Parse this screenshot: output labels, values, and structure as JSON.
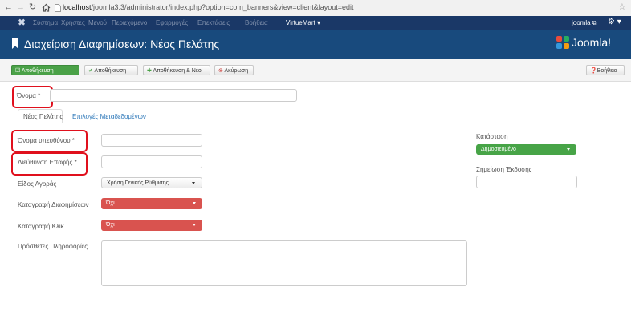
{
  "browser": {
    "back_icon": "back-arrow-icon",
    "forward_icon": "forward-arrow-icon",
    "reload_icon": "reload-icon",
    "home_icon": "home-icon",
    "page_icon": "page-icon",
    "url_host": "localhost",
    "url_path": "/joomla3.3/administrator/index.php?option=com_banners&view=client&layout=edit",
    "star_icon": "star-icon"
  },
  "topbar": {
    "logo_icon": "joomla-x-icon",
    "menu": [
      "Σύστημα",
      "Χρήστες",
      "Μενού",
      "Περιεχόμενο",
      "Εφαρμογές",
      "Επεκτάσεις",
      "Βοήθεια",
      "VirtueMart"
    ],
    "user_label": "joomla",
    "gear_icon": "gear-icon"
  },
  "header": {
    "title": "Διαχείριση Διαφημίσεων: Νέος Πελάτης",
    "brand": "Joomla!"
  },
  "toolbar": {
    "save": "Αποθήκευση",
    "save_close": "Αποθήκευση",
    "save_new": "Αποθήκευση & Νέο",
    "cancel": "Ακύρωση",
    "help": "Βοήθεια"
  },
  "form": {
    "name_label": "Όνομα *",
    "name_value": "",
    "tabs": [
      "Νέος Πελάτης",
      "Επιλογές Μεταδεδομένων"
    ],
    "contact_label": "Όνομα υπευθύνου *",
    "contact_value": "",
    "email_label": "Διεύθυνση Επαφής *",
    "email_value": "",
    "purchase_label": "Είδος Αγοράς",
    "purchase_value": "Χρήση Γενικής Ρύθμισης",
    "track_impressions_label": "Καταγραφή Διαφημίσεων",
    "track_impressions_value": "Όχι",
    "track_clicks_label": "Καταγραφή Κλικ",
    "track_clicks_value": "Όχι",
    "extra_label": "Πρόσθετες Πληροφορίες",
    "extra_value": "",
    "status_label": "Κατάσταση",
    "status_value": "Δημοσιευμένο",
    "version_note_label": "Σημείωση Έκδοσης",
    "version_note_value": ""
  },
  "colors": {
    "topbar": "#1a3867",
    "titlebar": "#184a7d",
    "save_green": "#4aa147",
    "published_green": "#47a447",
    "no_red": "#d9534f",
    "cancel_red": "#c9302c",
    "callout_red": "#e0101d",
    "link_blue": "#2e78b9"
  }
}
